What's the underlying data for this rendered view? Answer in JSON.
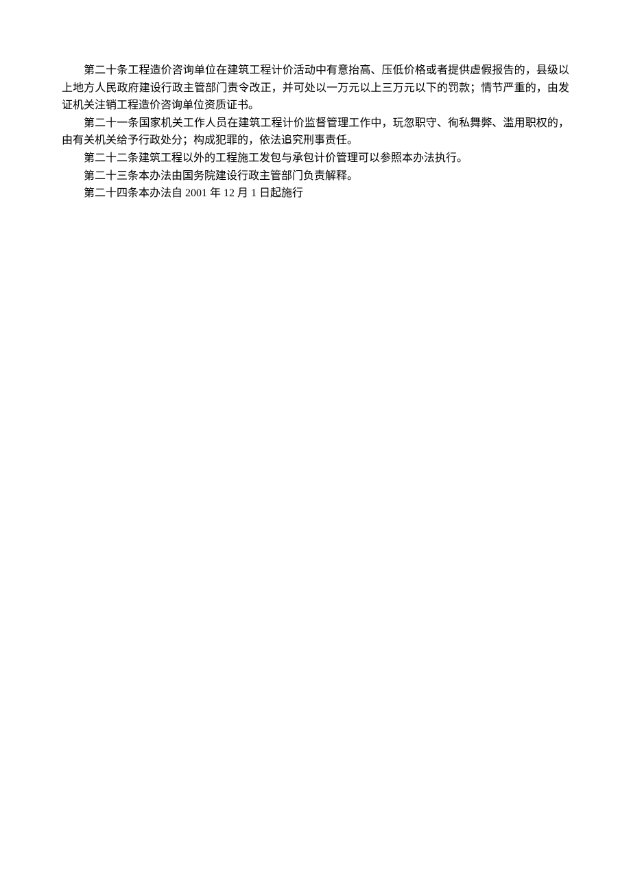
{
  "articles": {
    "article20": "第二十条工程造价咨询单位在建筑工程计价活动中有意抬高、压低价格或者提供虚假报告的，县级以上地方人民政府建设行政主管部门责令改正，并可处以一万元以上三万元以下的罚款；情节严重的，由发证机关注销工程造价咨询单位资质证书。",
    "article21": "第二十一条国家机关工作人员在建筑工程计价监督管理工作中，玩忽职守、徇私舞弊、滥用职权的，由有关机关给予行政处分；构成犯罪的，依法追究刑事责任。",
    "article22": "第二十二条建筑工程以外的工程施工发包与承包计价管理可以参照本办法执行。",
    "article23": "第二十三条本办法由国务院建设行政主管部门负责解释。",
    "article24": "第二十四条本办法自 2001 年 12 月 1 日起施行"
  }
}
